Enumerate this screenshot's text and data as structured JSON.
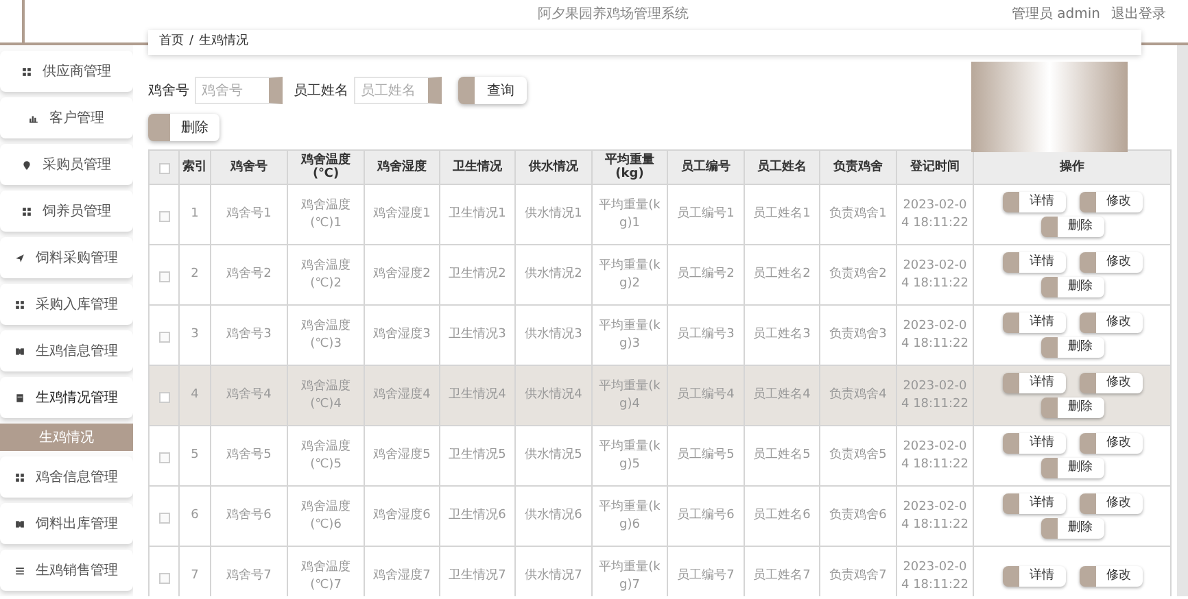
{
  "header": {
    "title": "阿夕果园养鸡场管理系统",
    "user": "管理员 admin",
    "logout": "退出登录"
  },
  "sidebar": {
    "items": [
      {
        "label": "供应商管理",
        "selected": false
      },
      {
        "label": "客户管理",
        "selected": false
      },
      {
        "label": "采购员管理",
        "selected": false
      },
      {
        "label": "饲养员管理",
        "selected": false
      },
      {
        "label": "饲料采购管理",
        "selected": false
      },
      {
        "label": "采购入库管理",
        "selected": false
      },
      {
        "label": "生鸡信息管理",
        "selected": false
      },
      {
        "label": "生鸡情况管理",
        "selected": false,
        "expanded": true,
        "children": [
          {
            "label": "生鸡情况",
            "selected": true
          }
        ]
      },
      {
        "label": "鸡舍信息管理",
        "selected": false
      },
      {
        "label": "饲料出库管理",
        "selected": false
      },
      {
        "label": "生鸡销售管理",
        "selected": false
      }
    ]
  },
  "breadcrumb": {
    "items": [
      "首页",
      "生鸡情况"
    ],
    "separator": "/"
  },
  "search": {
    "fields": [
      {
        "label": "鸡舍号",
        "placeholder": "鸡舍号"
      },
      {
        "label": "员工姓名",
        "placeholder": "员工姓名"
      }
    ],
    "button": "查询"
  },
  "delete_button": "删除",
  "table": {
    "select_all": {
      "checked": false
    },
    "columns": [
      "索引",
      "鸡舍号",
      "鸡舍温度(℃)",
      "鸡舍湿度",
      "卫生情况",
      "供水情况",
      "平均重量(kg)",
      "员工编号",
      "员工姓名",
      "负责鸡舍",
      "登记时间",
      "操作"
    ],
    "rows": [
      {
        "highlighted": false,
        "checked": false,
        "cells": [
          "1",
          "鸡舍号1",
          "鸡舍温度(℃)1",
          "鸡舍湿度1",
          "卫生情况1",
          "供水情况1",
          "平均重量(kg)1",
          "员工编号1",
          "员工姓名1",
          "负责鸡舍1",
          "2023-02-04 18:11:22"
        ],
        "actions": [
          "详情",
          "修改",
          "删除"
        ]
      },
      {
        "highlighted": false,
        "checked": false,
        "cells": [
          "2",
          "鸡舍号2",
          "鸡舍温度(℃)2",
          "鸡舍湿度2",
          "卫生情况2",
          "供水情况2",
          "平均重量(kg)2",
          "员工编号2",
          "员工姓名2",
          "负责鸡舍2",
          "2023-02-04 18:11:22"
        ],
        "actions": [
          "详情",
          "修改",
          "删除"
        ]
      },
      {
        "highlighted": false,
        "checked": false,
        "cells": [
          "3",
          "鸡舍号3",
          "鸡舍温度(℃)3",
          "鸡舍湿度3",
          "卫生情况3",
          "供水情况3",
          "平均重量(kg)3",
          "员工编号3",
          "员工姓名3",
          "负责鸡舍3",
          "2023-02-04 18:11:22"
        ],
        "actions": [
          "详情",
          "修改",
          "删除"
        ]
      },
      {
        "highlighted": true,
        "checked": false,
        "cells": [
          "4",
          "鸡舍号4",
          "鸡舍温度(℃)4",
          "鸡舍湿度4",
          "卫生情况4",
          "供水情况4",
          "平均重量(kg)4",
          "员工编号4",
          "员工姓名4",
          "负责鸡舍4",
          "2023-02-04 18:11:22"
        ],
        "actions": [
          "详情",
          "修改",
          "删除"
        ]
      },
      {
        "highlighted": false,
        "checked": false,
        "cells": [
          "5",
          "鸡舍号5",
          "鸡舍温度(℃)5",
          "鸡舍湿度5",
          "卫生情况5",
          "供水情况5",
          "平均重量(kg)5",
          "员工编号5",
          "员工姓名5",
          "负责鸡舍5",
          "2023-02-04 18:11:22"
        ],
        "actions": [
          "详情",
          "修改",
          "删除"
        ]
      },
      {
        "highlighted": false,
        "checked": false,
        "cells": [
          "6",
          "鸡舍号6",
          "鸡舍温度(℃)6",
          "鸡舍湿度6",
          "卫生情况6",
          "供水情况6",
          "平均重量(kg)6",
          "员工编号6",
          "员工姓名6",
          "负责鸡舍6",
          "2023-02-04 18:11:22"
        ],
        "actions": [
          "详情",
          "修改",
          "删除"
        ]
      },
      {
        "highlighted": false,
        "checked": false,
        "cells": [
          "7",
          "鸡舍号7",
          "鸡舍温度(℃)7",
          "鸡舍湿度7",
          "卫生情况7",
          "供水情况7",
          "平均重量(kg)7",
          "员工编号7",
          "员工姓名7",
          "负责鸡舍7",
          "2023-02-04 18:11:22"
        ],
        "actions": [
          "详情",
          "修改"
        ]
      }
    ]
  }
}
